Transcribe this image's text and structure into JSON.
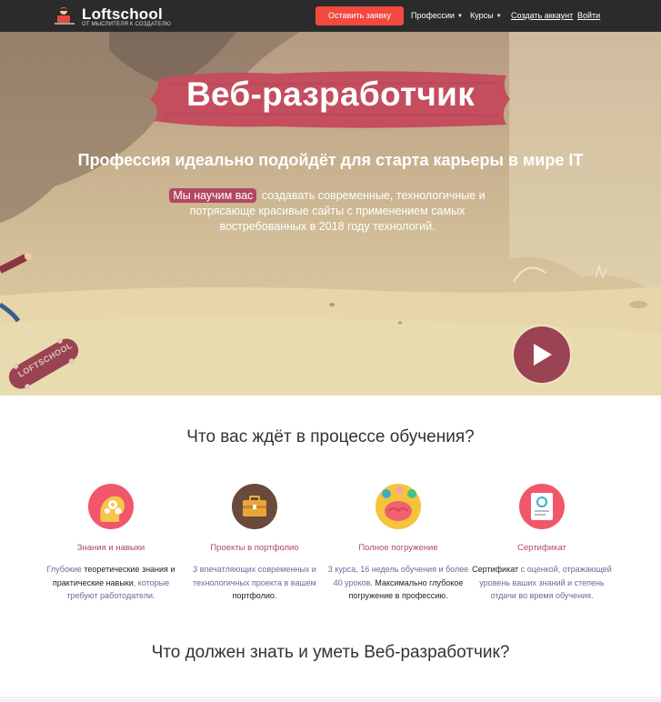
{
  "header": {
    "logo_name": "Loftschool",
    "logo_tagline": "от мыслителя к создателю",
    "cta_label": "Оставить заявку",
    "nav": [
      {
        "label": "Профессии"
      },
      {
        "label": "Курсы"
      }
    ],
    "create_account": "Создать аккаунт",
    "login": "Войти"
  },
  "hero": {
    "title": "Веб-разработчик",
    "subtitle": "Профессия идеально подойдёт для старта карьеры в мире IT",
    "desc_highlight": "Мы научим вас",
    "desc_rest": "создавать современные, технологичные и потрясающе красивые сайты с применением самых востребованных в 2018 году технологий.",
    "skateboard_text": "LOFTSCHOOL"
  },
  "learning": {
    "title": "Что вас ждёт в процессе обучения?",
    "features": [
      {
        "title": "Знания и навыки",
        "text_parts": [
          "Глубокие",
          " теоретические знания и практические навыки",
          ", которые требуют работодатели."
        ]
      },
      {
        "title": "Проекты в портфолио",
        "text_parts": [
          "3 впечатляющих современных и технологичных проекта в вашем",
          " портфолио."
        ]
      },
      {
        "title": "Полное погружение",
        "text_parts": [
          "3 курса, 16 недель обучения и более 40 уроков.",
          " Максимально глубокое погружение в профессию."
        ]
      },
      {
        "title": "Сертификат",
        "text_parts": [
          "Сертификат",
          " с оценкой, отражающей уровень ваших знаний и степень отдачи во время обучения."
        ]
      }
    ]
  },
  "skills": {
    "title": "Что должен знать и уметь Веб-разработчик?"
  },
  "colors": {
    "nav_bg": "#2b2b2b",
    "cta": "#f24a40",
    "accent": "#b24860",
    "play": "#9b4352"
  }
}
